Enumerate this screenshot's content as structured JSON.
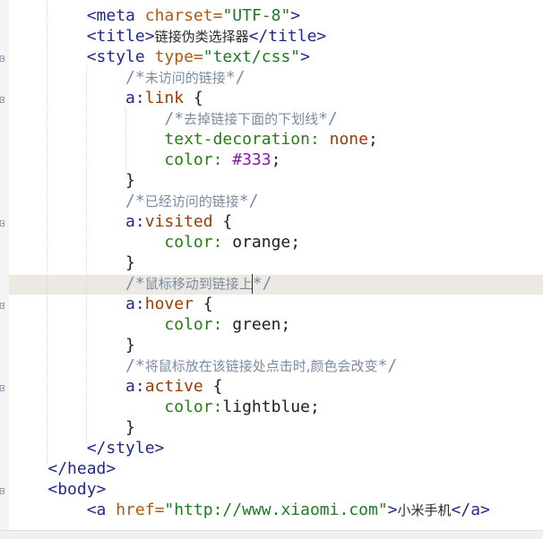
{
  "editor": {
    "lines": [
      {
        "indent": "        ",
        "parts": [
          [
            "t",
            "<meta "
          ],
          [
            "a",
            "charset="
          ],
          [
            "s",
            "\"UTF-8\""
          ],
          [
            "t",
            ">"
          ]
        ]
      },
      {
        "indent": "        ",
        "parts": [
          [
            "t",
            "<title>"
          ],
          [
            "cjk",
            "链接伪类选择器"
          ],
          [
            "t",
            "</title>"
          ]
        ]
      },
      {
        "indent": "        ",
        "parts": [
          [
            "t",
            "<style "
          ],
          [
            "a",
            "type="
          ],
          [
            "s",
            "\"text/css\""
          ],
          [
            "t",
            ">"
          ]
        ]
      },
      {
        "indent": "            ",
        "parts": [
          [
            "c",
            "/*"
          ],
          [
            "c cjk",
            "未访问的链接"
          ],
          [
            "c",
            "*/"
          ]
        ]
      },
      {
        "indent": "            ",
        "parts": [
          [
            "sel",
            "a:"
          ],
          [
            "val",
            "link"
          ],
          [
            "txt",
            " {"
          ]
        ]
      },
      {
        "indent": "                ",
        "parts": [
          [
            "c",
            "/*"
          ],
          [
            "c cjk",
            "去掉链接下面的下划线"
          ],
          [
            "c",
            "*/"
          ]
        ]
      },
      {
        "indent": "                ",
        "parts": [
          [
            "prop",
            "text-decoration: "
          ],
          [
            "val",
            "none"
          ],
          [
            "txt",
            ";"
          ]
        ]
      },
      {
        "indent": "                ",
        "parts": [
          [
            "prop",
            "color: "
          ],
          [
            "hex",
            "#333"
          ],
          [
            "txt",
            ";"
          ]
        ]
      },
      {
        "indent": "            ",
        "parts": [
          [
            "txt",
            "}"
          ]
        ]
      },
      {
        "indent": "            ",
        "parts": [
          [
            "c",
            "/*"
          ],
          [
            "c cjk",
            "已经访问的链接"
          ],
          [
            "c",
            "*/"
          ]
        ]
      },
      {
        "indent": "            ",
        "parts": [
          [
            "sel",
            "a:"
          ],
          [
            "val",
            "visited"
          ],
          [
            "txt",
            " {"
          ]
        ]
      },
      {
        "indent": "                ",
        "parts": [
          [
            "prop",
            "color: "
          ],
          [
            "txt",
            "orange;"
          ]
        ]
      },
      {
        "indent": "            ",
        "parts": [
          [
            "txt",
            "}"
          ]
        ]
      },
      {
        "indent": "            ",
        "parts": [
          [
            "c",
            "/*"
          ],
          [
            "c cjk",
            "鼠标移动到链接上"
          ],
          [
            "c",
            "*/"
          ]
        ]
      },
      {
        "indent": "            ",
        "parts": [
          [
            "sel",
            "a:"
          ],
          [
            "val",
            "hover"
          ],
          [
            "txt",
            " {"
          ]
        ]
      },
      {
        "indent": "                ",
        "parts": [
          [
            "prop",
            "color: "
          ],
          [
            "txt",
            "green;"
          ]
        ]
      },
      {
        "indent": "            ",
        "parts": [
          [
            "txt",
            "}"
          ]
        ]
      },
      {
        "indent": "            ",
        "parts": [
          [
            "c",
            "/*"
          ],
          [
            "c cjk",
            "将鼠标放在该链接处点击时,颜色会改变"
          ],
          [
            "c",
            "*/"
          ]
        ]
      },
      {
        "indent": "            ",
        "parts": [
          [
            "sel",
            "a:"
          ],
          [
            "val",
            "active"
          ],
          [
            "txt",
            " {"
          ]
        ]
      },
      {
        "indent": "                ",
        "parts": [
          [
            "prop",
            "color:"
          ],
          [
            "txt",
            "lightblue;"
          ]
        ]
      },
      {
        "indent": "            ",
        "parts": [
          [
            "txt",
            "}"
          ]
        ]
      },
      {
        "indent": "        ",
        "parts": [
          [
            "t",
            "</style>"
          ]
        ]
      },
      {
        "indent": "    ",
        "parts": [
          [
            "t",
            "</head>"
          ]
        ]
      },
      {
        "indent": "    ",
        "parts": [
          [
            "t",
            "<body>"
          ]
        ]
      },
      {
        "indent": "        ",
        "parts": [
          [
            "t",
            "<a "
          ],
          [
            "a",
            "href="
          ],
          [
            "s",
            "\"http://www.xiaomi.com\""
          ],
          [
            "t",
            ">"
          ],
          [
            "cjk",
            "小米手机"
          ],
          [
            "t",
            "</a>"
          ]
        ]
      }
    ]
  }
}
